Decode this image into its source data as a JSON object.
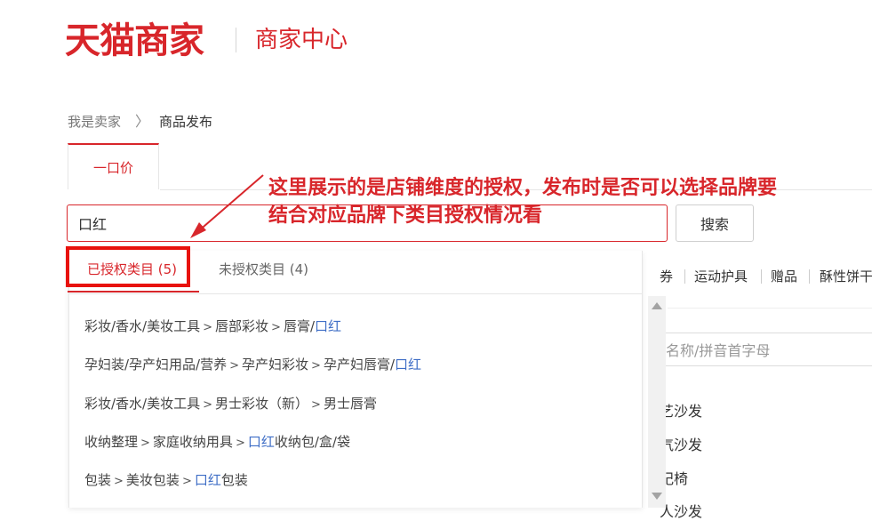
{
  "header": {
    "logo_text": "天猫商家",
    "center_title": "商家中心"
  },
  "breadcrumb": {
    "home": "我是卖家",
    "separator": "〉",
    "current": "商品发布"
  },
  "tabs": [
    {
      "label": "一口价",
      "active": true
    }
  ],
  "search": {
    "value": "口红",
    "button_label": "搜索"
  },
  "annotation": {
    "line1": "这里展示的是店铺维度的授权，发布时是否可以选择品牌要",
    "line2": "结合对应品牌下类目授权情况看"
  },
  "dropdown": {
    "tab_authorized": "已授权类目 (5)",
    "tab_unauthorized": "未授权类目 (4)",
    "results": [
      {
        "parts": [
          "彩妆/香水/美妆工具",
          "唇部彩妆",
          "唇膏/"
        ],
        "highlight": "口红",
        "tail": ""
      },
      {
        "parts": [
          "孕妇装/孕产妇用品/营养",
          "孕产妇彩妆",
          "孕产妇唇膏/"
        ],
        "highlight": "口红",
        "tail": ""
      },
      {
        "parts": [
          "彩妆/香水/美妆工具",
          "男士彩妆（新）",
          "男士唇膏"
        ],
        "highlight": "",
        "tail": ""
      },
      {
        "parts": [
          "收纳整理",
          "家庭收纳用具",
          ""
        ],
        "highlight": "口红",
        "tail": "收纳包/盒/袋"
      },
      {
        "parts": [
          "包装",
          "美妆包装",
          ""
        ],
        "highlight": "口红",
        "tail": "包装"
      }
    ]
  },
  "background": {
    "nav_partial": "券",
    "nav_items": [
      "运动护具",
      "赠品",
      "酥性饼干"
    ],
    "filter_placeholder": "名称/拼音首字母",
    "list_items": [
      "艺沙发",
      "气沙发",
      "妃椅",
      "人沙发"
    ]
  },
  "colors": {
    "brand_red": "#d8262b",
    "link_blue": "#3f6ec6"
  }
}
